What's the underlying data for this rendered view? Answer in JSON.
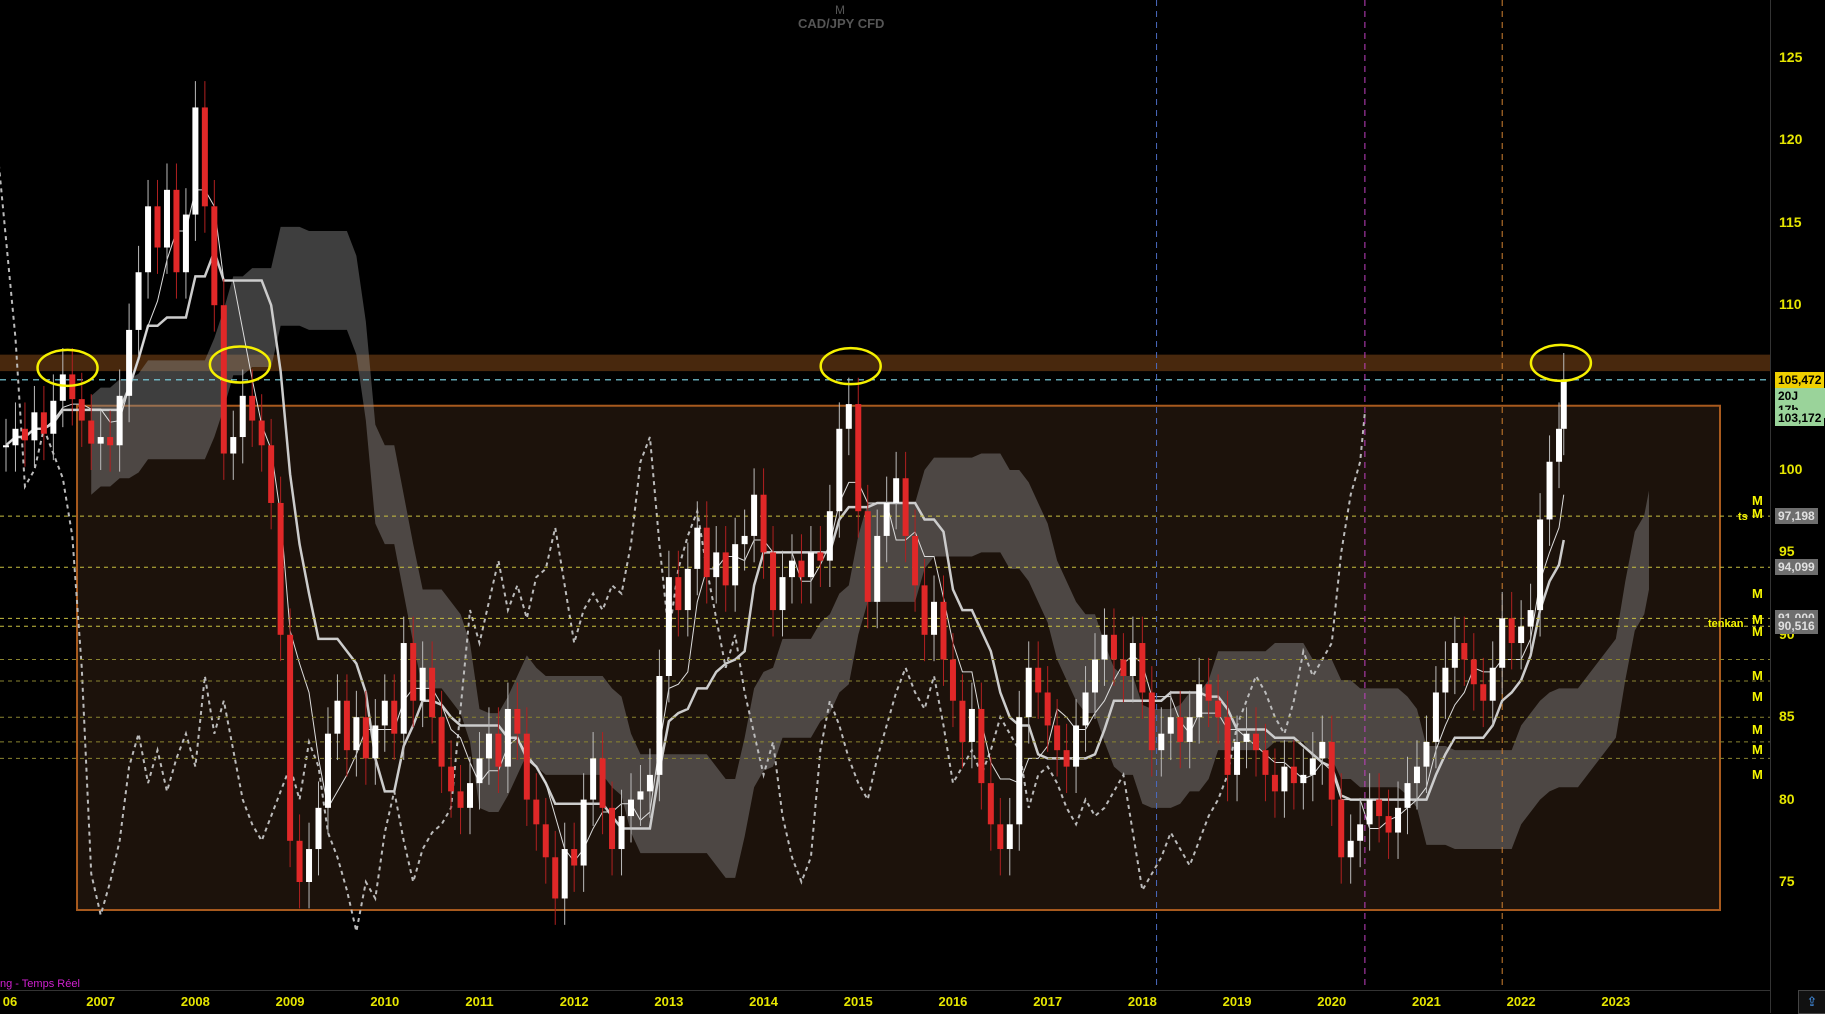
{
  "header": {
    "timeframe": "M",
    "instrument": "CAD/JPY CFD"
  },
  "footer": {
    "status": "ng - Temps Réel"
  },
  "price_labels": [
    {
      "value": "105,472",
      "bg": "#f0d000",
      "fg": "#000000"
    },
    {
      "value": "20J 17h",
      "bg": "#9ad39a",
      "fg": "#000000"
    },
    {
      "value": "103,172",
      "bg": "#9ad39a",
      "fg": "#000000"
    },
    {
      "value": "97,198",
      "bg": "#6e6e6e",
      "fg": "#e0e0e0"
    },
    {
      "value": "94,099",
      "bg": "#6e6e6e",
      "fg": "#e0e0e0"
    },
    {
      "value": "91,000",
      "bg": "#6e6e6e",
      "fg": "#e0e0e0"
    },
    {
      "value": "90,516",
      "bg": "#6e6e6e",
      "fg": "#e0e0e0"
    }
  ],
  "level_markers": [
    "M",
    "M",
    "M",
    "M",
    "M",
    "M",
    "M",
    "M",
    "M",
    "M"
  ],
  "line_labels": [
    "ts",
    "tenkan"
  ],
  "corner_button": "⇪",
  "colors": {
    "bull": "#ffffff",
    "bear": "#e02828",
    "resistance_band": "#5a3210",
    "range_fill": "#1c120b",
    "range_border": "#a85a1e",
    "kumo": "#8a8a8a",
    "circle": "#f5f000",
    "cyan_line": "#7fd8e8"
  },
  "chart_data": {
    "type": "candlestick",
    "title": "CAD/JPY CFD",
    "timeframe": "M",
    "yticks": [
      75,
      80,
      85,
      90,
      95,
      100,
      105,
      110,
      115,
      120,
      125
    ],
    "ylim": [
      70,
      128
    ],
    "xticks": [
      "06",
      "2007",
      "2008",
      "2009",
      "2010",
      "2011",
      "2012",
      "2013",
      "2014",
      "2015",
      "2016",
      "2017",
      "2018",
      "2019",
      "2020",
      "2021",
      "2022",
      "2023"
    ],
    "xlim": [
      2006.0,
      2024.1
    ],
    "resistance_zone": [
      106.0,
      107.0
    ],
    "range_box": {
      "x": [
        2006.75,
        2024.1
      ],
      "y": [
        73.3,
        103.9
      ]
    },
    "current_price": 105.472,
    "horizontal_levels": [
      97.198,
      94.099,
      91.0,
      90.516
    ],
    "highlighted_tops": [
      {
        "x": 2006.65,
        "y": 106.2
      },
      {
        "x": 2008.47,
        "y": 106.4
      },
      {
        "x": 2014.92,
        "y": 106.3
      },
      {
        "x": 2022.42,
        "y": 106.5
      }
    ],
    "vertical_markers": [
      {
        "x": 2018.15,
        "color": "#4a6abf"
      },
      {
        "x": 2020.35,
        "color": "#c040c0"
      },
      {
        "x": 2021.8,
        "color": "#d08030"
      }
    ],
    "monthly_closes": [
      [
        2006.0,
        101.5
      ],
      [
        2006.1,
        102.5
      ],
      [
        2006.2,
        101.8
      ],
      [
        2006.3,
        103.5
      ],
      [
        2006.4,
        102.2
      ],
      [
        2006.5,
        104.2
      ],
      [
        2006.6,
        105.8
      ],
      [
        2006.7,
        104.3
      ],
      [
        2006.8,
        103.0
      ],
      [
        2006.9,
        101.6
      ],
      [
        2007.0,
        102.0
      ],
      [
        2007.1,
        101.5
      ],
      [
        2007.2,
        104.5
      ],
      [
        2007.3,
        108.5
      ],
      [
        2007.4,
        112.0
      ],
      [
        2007.5,
        116.0
      ],
      [
        2007.6,
        113.5
      ],
      [
        2007.7,
        117.0
      ],
      [
        2007.8,
        112.0
      ],
      [
        2007.9,
        115.5
      ],
      [
        2008.0,
        122.0
      ],
      [
        2008.1,
        116.0
      ],
      [
        2008.2,
        110.0
      ],
      [
        2008.3,
        101.0
      ],
      [
        2008.4,
        102.0
      ],
      [
        2008.5,
        104.5
      ],
      [
        2008.6,
        103.0
      ],
      [
        2008.7,
        101.5
      ],
      [
        2008.8,
        98.0
      ],
      [
        2008.9,
        90.0
      ],
      [
        2009.0,
        77.5
      ],
      [
        2009.1,
        75.0
      ],
      [
        2009.2,
        77.0
      ],
      [
        2009.3,
        79.5
      ],
      [
        2009.4,
        84.0
      ],
      [
        2009.5,
        86.0
      ],
      [
        2009.6,
        83.0
      ],
      [
        2009.7,
        85.0
      ],
      [
        2009.8,
        82.5
      ],
      [
        2009.9,
        84.5
      ],
      [
        2010.0,
        86.0
      ],
      [
        2010.1,
        84.0
      ],
      [
        2010.2,
        89.5
      ],
      [
        2010.3,
        86.0
      ],
      [
        2010.4,
        88.0
      ],
      [
        2010.5,
        85.0
      ],
      [
        2010.6,
        82.0
      ],
      [
        2010.7,
        80.5
      ],
      [
        2010.8,
        79.5
      ],
      [
        2010.9,
        81.0
      ],
      [
        2011.0,
        82.5
      ],
      [
        2011.1,
        84.0
      ],
      [
        2011.2,
        82.0
      ],
      [
        2011.3,
        85.5
      ],
      [
        2011.4,
        84.0
      ],
      [
        2011.5,
        80.0
      ],
      [
        2011.6,
        78.5
      ],
      [
        2011.7,
        76.5
      ],
      [
        2011.8,
        74.0
      ],
      [
        2011.9,
        77.0
      ],
      [
        2012.0,
        76.0
      ],
      [
        2012.1,
        80.0
      ],
      [
        2012.2,
        82.5
      ],
      [
        2012.3,
        79.5
      ],
      [
        2012.4,
        77.0
      ],
      [
        2012.5,
        79.0
      ],
      [
        2012.6,
        80.0
      ],
      [
        2012.7,
        80.5
      ],
      [
        2012.8,
        81.5
      ],
      [
        2012.9,
        87.5
      ],
      [
        2013.0,
        93.5
      ],
      [
        2013.1,
        91.5
      ],
      [
        2013.2,
        94.0
      ],
      [
        2013.3,
        96.5
      ],
      [
        2013.4,
        93.5
      ],
      [
        2013.5,
        95.0
      ],
      [
        2013.6,
        93.0
      ],
      [
        2013.7,
        95.5
      ],
      [
        2013.8,
        96.0
      ],
      [
        2013.9,
        98.5
      ],
      [
        2014.0,
        95.0
      ],
      [
        2014.1,
        91.5
      ],
      [
        2014.2,
        93.5
      ],
      [
        2014.3,
        94.5
      ],
      [
        2014.4,
        93.5
      ],
      [
        2014.5,
        95.0
      ],
      [
        2014.6,
        94.5
      ],
      [
        2014.7,
        97.5
      ],
      [
        2014.8,
        102.5
      ],
      [
        2014.9,
        104.0
      ],
      [
        2015.0,
        97.5
      ],
      [
        2015.1,
        92.0
      ],
      [
        2015.2,
        96.0
      ],
      [
        2015.3,
        98.0
      ],
      [
        2015.4,
        99.5
      ],
      [
        2015.5,
        96.0
      ],
      [
        2015.6,
        93.0
      ],
      [
        2015.7,
        90.0
      ],
      [
        2015.8,
        92.0
      ],
      [
        2015.9,
        88.5
      ],
      [
        2016.0,
        86.0
      ],
      [
        2016.1,
        83.5
      ],
      [
        2016.2,
        85.5
      ],
      [
        2016.3,
        81.0
      ],
      [
        2016.4,
        78.5
      ],
      [
        2016.5,
        77.0
      ],
      [
        2016.6,
        78.5
      ],
      [
        2016.7,
        85.0
      ],
      [
        2016.8,
        88.0
      ],
      [
        2016.9,
        86.5
      ],
      [
        2017.0,
        84.5
      ],
      [
        2017.1,
        83.0
      ],
      [
        2017.2,
        82.0
      ],
      [
        2017.3,
        84.5
      ],
      [
        2017.4,
        86.5
      ],
      [
        2017.5,
        88.5
      ],
      [
        2017.6,
        90.0
      ],
      [
        2017.7,
        88.5
      ],
      [
        2017.8,
        87.5
      ],
      [
        2017.9,
        89.5
      ],
      [
        2018.0,
        86.5
      ],
      [
        2018.1,
        83.0
      ],
      [
        2018.2,
        84.0
      ],
      [
        2018.3,
        85.0
      ],
      [
        2018.4,
        83.5
      ],
      [
        2018.5,
        85.0
      ],
      [
        2018.6,
        87.0
      ],
      [
        2018.7,
        86.0
      ],
      [
        2018.8,
        85.0
      ],
      [
        2018.9,
        81.5
      ],
      [
        2019.0,
        83.5
      ],
      [
        2019.1,
        84.0
      ],
      [
        2019.2,
        83.0
      ],
      [
        2019.3,
        81.5
      ],
      [
        2019.4,
        80.5
      ],
      [
        2019.5,
        82.0
      ],
      [
        2019.6,
        81.0
      ],
      [
        2019.7,
        81.5
      ],
      [
        2019.8,
        82.5
      ],
      [
        2019.9,
        83.5
      ],
      [
        2020.0,
        80.0
      ],
      [
        2020.1,
        76.5
      ],
      [
        2020.2,
        77.5
      ],
      [
        2020.3,
        78.5
      ],
      [
        2020.4,
        80.0
      ],
      [
        2020.5,
        79.0
      ],
      [
        2020.6,
        78.0
      ],
      [
        2020.7,
        79.5
      ],
      [
        2020.8,
        81.0
      ],
      [
        2020.9,
        82.0
      ],
      [
        2021.0,
        83.5
      ],
      [
        2021.1,
        86.5
      ],
      [
        2021.2,
        88.0
      ],
      [
        2021.3,
        89.5
      ],
      [
        2021.4,
        88.5
      ],
      [
        2021.5,
        87.0
      ],
      [
        2021.6,
        86.0
      ],
      [
        2021.7,
        88.0
      ],
      [
        2021.8,
        91.0
      ],
      [
        2021.9,
        89.5
      ],
      [
        2022.0,
        90.5
      ],
      [
        2022.1,
        91.5
      ],
      [
        2022.2,
        97.0
      ],
      [
        2022.3,
        100.5
      ],
      [
        2022.4,
        102.5
      ],
      [
        2022.45,
        105.5
      ]
    ]
  }
}
